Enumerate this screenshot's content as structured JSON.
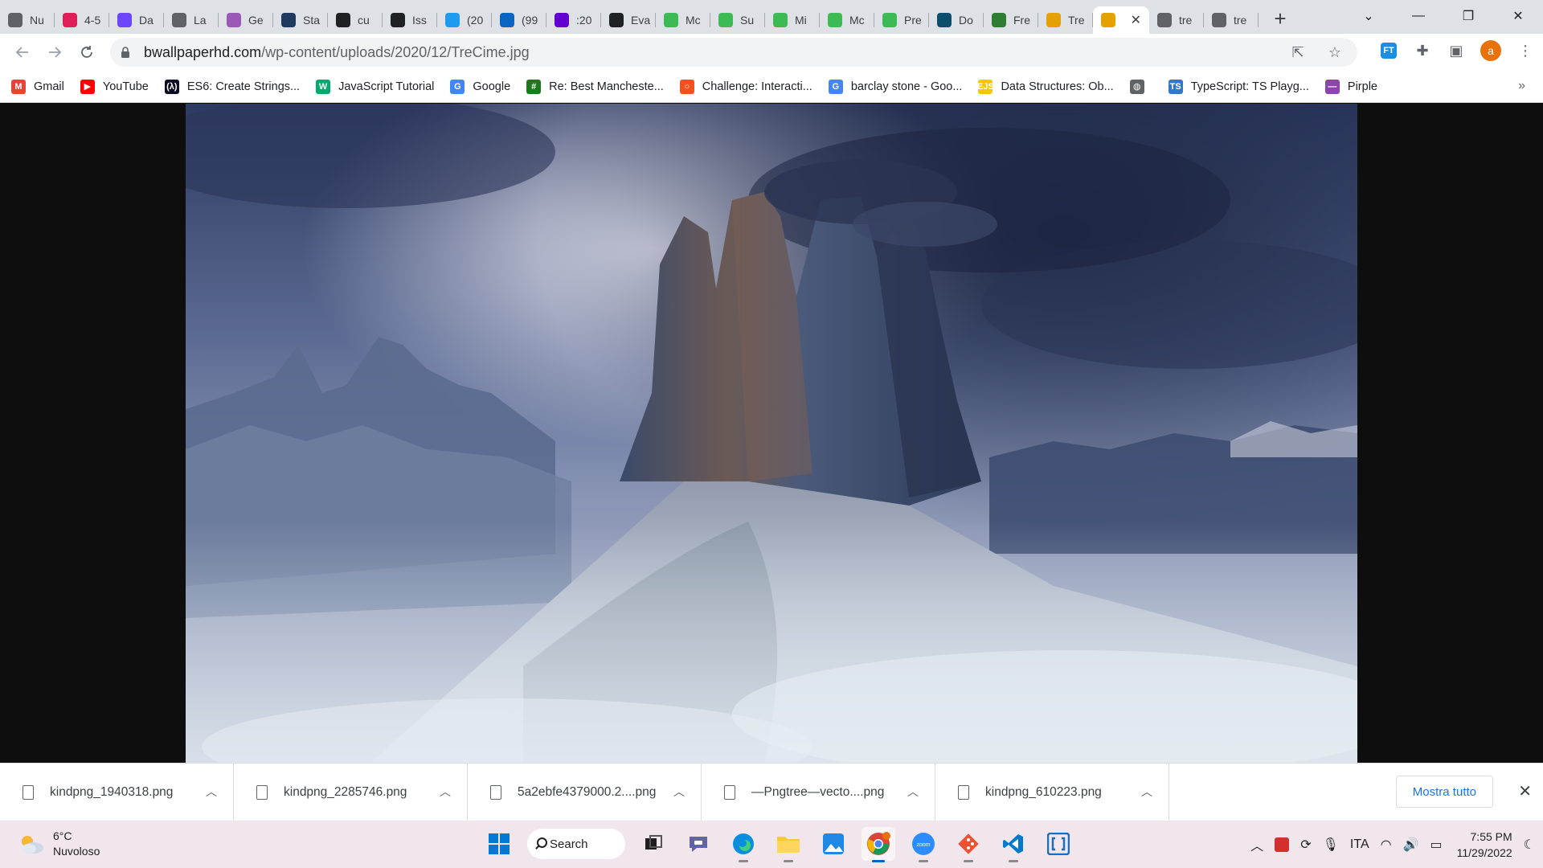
{
  "browser": {
    "tabs": [
      {
        "title": "Nu",
        "icon": "globe-icon",
        "color": "#5f6368"
      },
      {
        "title": "4-5",
        "icon": "slack-icon",
        "color": "#e01e5a"
      },
      {
        "title": "Da",
        "icon": "monday-icon",
        "color": "#6c47ff"
      },
      {
        "title": "La",
        "icon": "globe-icon",
        "color": "#5f6368"
      },
      {
        "title": "Ge",
        "icon": "graphql-icon",
        "color": "#9b59b6"
      },
      {
        "title": "Sta",
        "icon": "react-icon",
        "color": "#1e3a5f"
      },
      {
        "title": "cu",
        "icon": "github-icon",
        "color": "#202124"
      },
      {
        "title": "Iss",
        "icon": "github-icon",
        "color": "#202124"
      },
      {
        "title": "(20",
        "icon": "twitter-icon",
        "color": "#1d9bf0"
      },
      {
        "title": "(99",
        "icon": "linkedin-icon",
        "color": "#0a66c2"
      },
      {
        "title": ":20",
        "icon": "yahoo-icon",
        "color": "#6001d2"
      },
      {
        "title": "Eva",
        "icon": "github-icon",
        "color": "#202124"
      },
      {
        "title": "Mc",
        "icon": "chat-icon",
        "color": "#3cba54"
      },
      {
        "title": "Su",
        "icon": "chat-icon",
        "color": "#3cba54"
      },
      {
        "title": "Mi",
        "icon": "chat-icon",
        "color": "#3cba54"
      },
      {
        "title": "Mc",
        "icon": "chat-icon",
        "color": "#3cba54"
      },
      {
        "title": "Pre",
        "icon": "chat-icon",
        "color": "#3cba54"
      },
      {
        "title": "Do",
        "icon": "kp-icon",
        "color": "#0b4f6c"
      },
      {
        "title": "Fre",
        "icon": "leaf-icon",
        "color": "#2e7d32"
      },
      {
        "title": "Tre",
        "icon": "flower-icon",
        "color": "#e5a100"
      },
      {
        "title": "",
        "icon": "flower-icon",
        "color": "#e5a100",
        "active": true
      },
      {
        "title": "tre",
        "icon": "globe-icon",
        "color": "#5f6368"
      },
      {
        "title": "tre",
        "icon": "globe-icon",
        "color": "#5f6368"
      }
    ],
    "new_tab_label": "+",
    "close_tab_label": "✕",
    "address": {
      "host": "bwallpaperhd.com",
      "path": "/wp-content/uploads/2020/12/TreCime.jpg"
    },
    "profile_initial": "a",
    "extension_label": "FT"
  },
  "bookmarks": [
    {
      "label": "Gmail",
      "icon": "gmail-icon",
      "color": "#ea4335",
      "glyph": "M"
    },
    {
      "label": "YouTube",
      "icon": "youtube-icon",
      "color": "#ff0000",
      "glyph": "▶"
    },
    {
      "label": "ES6: Create Strings...",
      "icon": "freecodecamp-icon",
      "color": "#0a0a23",
      "glyph": "(λ)"
    },
    {
      "label": "JavaScript Tutorial",
      "icon": "w3schools-icon",
      "color": "#04aa6d",
      "glyph": "W"
    },
    {
      "label": "Google",
      "icon": "google-icon",
      "color": "#4285f4",
      "glyph": "G"
    },
    {
      "label": "Re: Best Mancheste...",
      "icon": "forum-icon",
      "color": "#1b7a1b",
      "glyph": "#"
    },
    {
      "label": "Challenge: Interacti...",
      "icon": "codecademy-icon",
      "color": "#f4511e",
      "glyph": "○"
    },
    {
      "label": "barclay stone - Goo...",
      "icon": "google-icon",
      "color": "#4285f4",
      "glyph": "G"
    },
    {
      "label": "Data Structures: Ob...",
      "icon": "ejs-icon",
      "color": "#f7c600",
      "glyph": "EJS"
    },
    {
      "label": "",
      "icon": "globe-icon",
      "color": "#5f6368",
      "glyph": "◍"
    },
    {
      "label": "TypeScript: TS Playg...",
      "icon": "typescript-icon",
      "color": "#3178c6",
      "glyph": "TS"
    },
    {
      "label": "Pirple",
      "icon": "pirple-icon",
      "color": "#8e44ad",
      "glyph": "—"
    }
  ],
  "bookmarks_more": "»",
  "downloads": {
    "items": [
      {
        "name": "kindpng_1940318.png"
      },
      {
        "name": "kindpng_2285746.png"
      },
      {
        "name": "5a2ebfe4379000.2....png"
      },
      {
        "name": "—Pngtree—vecto....png"
      },
      {
        "name": "kindpng_610223.png"
      }
    ],
    "show_all_label": "Mostra tutto",
    "close_label": "✕"
  },
  "taskbar": {
    "weather": {
      "temp": "6°C",
      "condition": "Nuvoloso"
    },
    "search_label": "Search",
    "language": "ITA",
    "time": "7:55 PM",
    "date": "11/29/2022",
    "apps": [
      {
        "name": "start-icon"
      },
      {
        "name": "search-box"
      },
      {
        "name": "task-view-icon"
      },
      {
        "name": "teams-chat-icon"
      },
      {
        "name": "edge-icon"
      },
      {
        "name": "file-explorer-icon"
      },
      {
        "name": "photos-icon"
      },
      {
        "name": "chrome-icon",
        "active": true
      },
      {
        "name": "zoom-icon"
      },
      {
        "name": "git-icon"
      },
      {
        "name": "vscode-icon"
      },
      {
        "name": "brackets-icon"
      }
    ]
  },
  "colors": {
    "tabstrip_bg": "#dee1e6",
    "accent_blue": "#1a73e8",
    "taskbar_bg": "#f0e6ec",
    "viewer_bg": "#0e0e0e"
  }
}
